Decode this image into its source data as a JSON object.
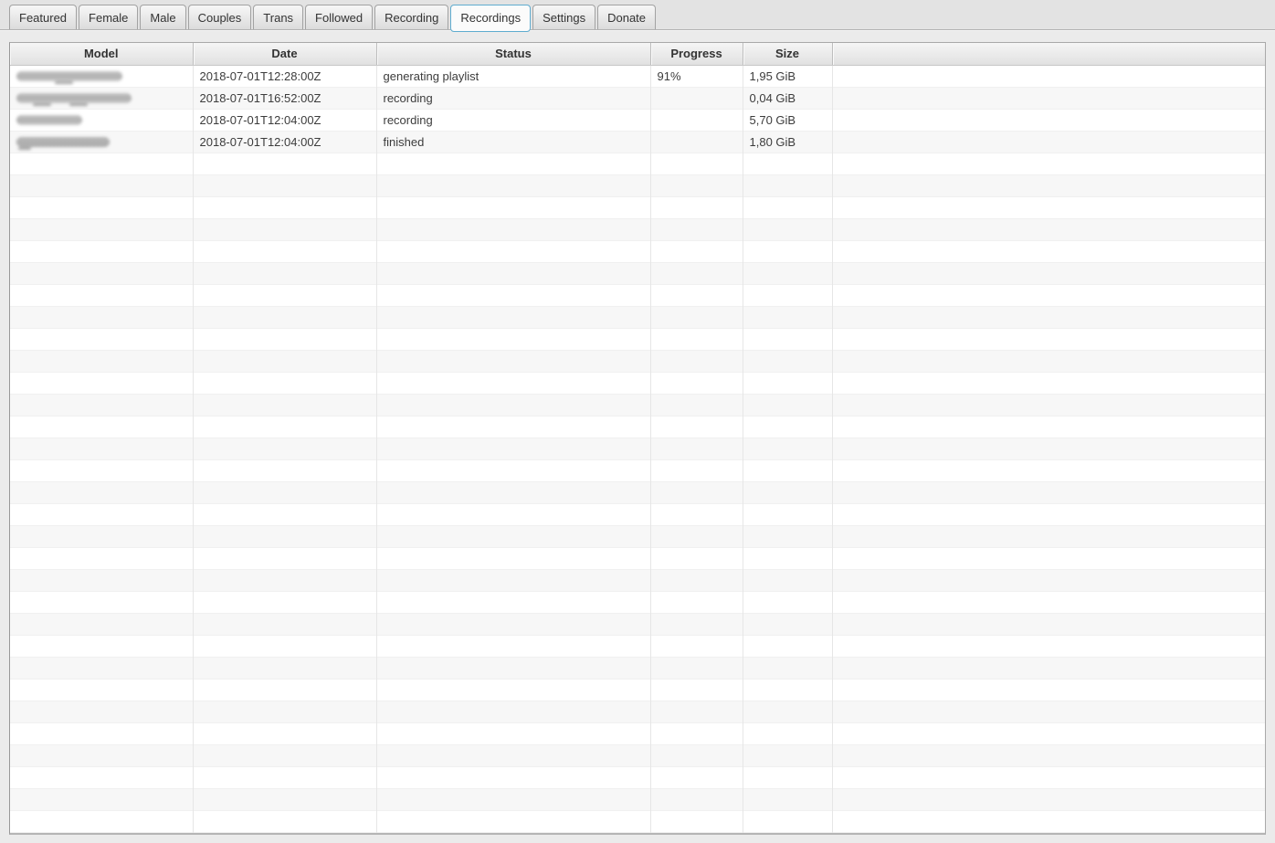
{
  "tabs": [
    {
      "label": "Featured",
      "active": false
    },
    {
      "label": "Female",
      "active": false
    },
    {
      "label": "Male",
      "active": false
    },
    {
      "label": "Couples",
      "active": false
    },
    {
      "label": "Trans",
      "active": false
    },
    {
      "label": "Followed",
      "active": false
    },
    {
      "label": "Recording",
      "active": false
    },
    {
      "label": "Recordings",
      "active": true
    },
    {
      "label": "Settings",
      "active": false
    },
    {
      "label": "Donate",
      "active": false
    }
  ],
  "table": {
    "columns": [
      "Model",
      "Date",
      "Status",
      "Progress",
      "Size",
      ""
    ],
    "rows": [
      {
        "model": "",
        "model_redacted": true,
        "date": "2018-07-01T12:28:00Z",
        "status": "generating playlist",
        "progress": "91%",
        "size": "1,95 GiB"
      },
      {
        "model": "",
        "model_redacted": true,
        "date": "2018-07-01T16:52:00Z",
        "status": "recording",
        "progress": "",
        "size": "0,04 GiB"
      },
      {
        "model": "",
        "model_redacted": true,
        "date": "2018-07-01T12:04:00Z",
        "status": "recording",
        "progress": "",
        "size": "5,70 GiB"
      },
      {
        "model": "",
        "model_redacted": true,
        "date": "2018-07-01T12:04:00Z",
        "status": "finished",
        "progress": "",
        "size": "1,80 GiB"
      }
    ],
    "empty_row_count": 31
  },
  "colors": {
    "active_tab_border": "#5faccf",
    "page_background": "#ebebeb",
    "row_stripe": "#f7f7f7",
    "header_text": "#333333",
    "cell_text": "#3c3c3c"
  }
}
